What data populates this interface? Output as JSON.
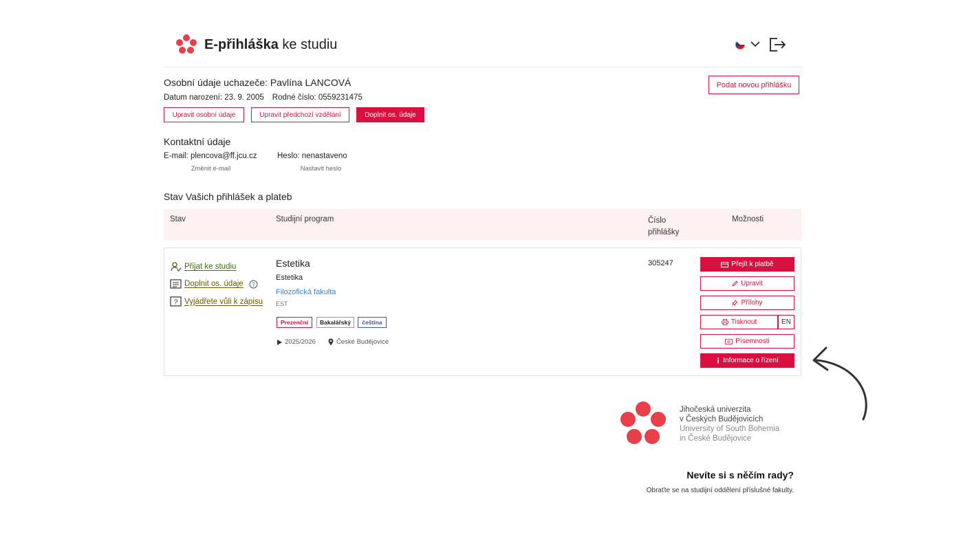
{
  "header": {
    "brand_bold": "E-přihláška",
    "brand_rest": " ke studiu",
    "language_icon": "czech-flag-icon",
    "logout_icon": "logout-icon"
  },
  "personal": {
    "title": "Osobní údaje uchazeče: Pavlína LANCOVÁ",
    "dob": "Datum narození: 23. 9. 2005",
    "birth_number": "Rodné číslo: 0559231475",
    "buttons": {
      "edit_personal": "Upravit osobní údaje",
      "edit_education": "Upravit předchozí vzdělání",
      "complete_data": "Doplnit os. údaje"
    },
    "new_application": "Podat novou přihlášku"
  },
  "contact": {
    "title": "Kontaktní údaje",
    "email": "E-mail: plencova@ff.jcu.cz",
    "change_email": "Změnit e-mail",
    "password": "Heslo: nenastaveno",
    "set_password": "Nastavit heslo"
  },
  "applications": {
    "title": "Stav Vašich přihlášek a plateb",
    "columns": {
      "status": "Stav",
      "program": "Studijní program",
      "number": "Číslo přihlášky",
      "options": "Možnosti"
    },
    "row": {
      "statuses": [
        "Přijat ke studiu",
        "Doplnit os. údaje",
        "Vyjádřete vůli k zápisu"
      ],
      "program_name": "Estetika",
      "program_sub": "Estetika",
      "faculty": "Filozofická fakulta",
      "code": "EST",
      "tags": [
        "Prezenční",
        "Bakalářský",
        "čeština"
      ],
      "year": "2025/2026",
      "city": "České Budějovice",
      "app_number": "305247",
      "options": {
        "pay": "Přejít k platbě",
        "edit": "Upravit",
        "attachments": "Přílohy",
        "print": "Tisknout",
        "print_lang": "EN",
        "documents": "Písemnosti",
        "info": "Informace o řízení"
      }
    }
  },
  "university": {
    "name_cz_1": "Jihočeská univerzita",
    "name_cz_2": "v Českých Budějovicích",
    "name_en_1": "University of South Bohemia",
    "name_en_2": "in České Budějovice"
  },
  "help": {
    "title": "Nevíte si s něčím rady?",
    "text": "Obraťte se na studijní oddělení příslušné fakulty."
  },
  "colors": {
    "accent": "#d8103f",
    "header_row": "#fdf1f3",
    "link": "#3d7fc1",
    "accepted": "#3d6d12"
  }
}
